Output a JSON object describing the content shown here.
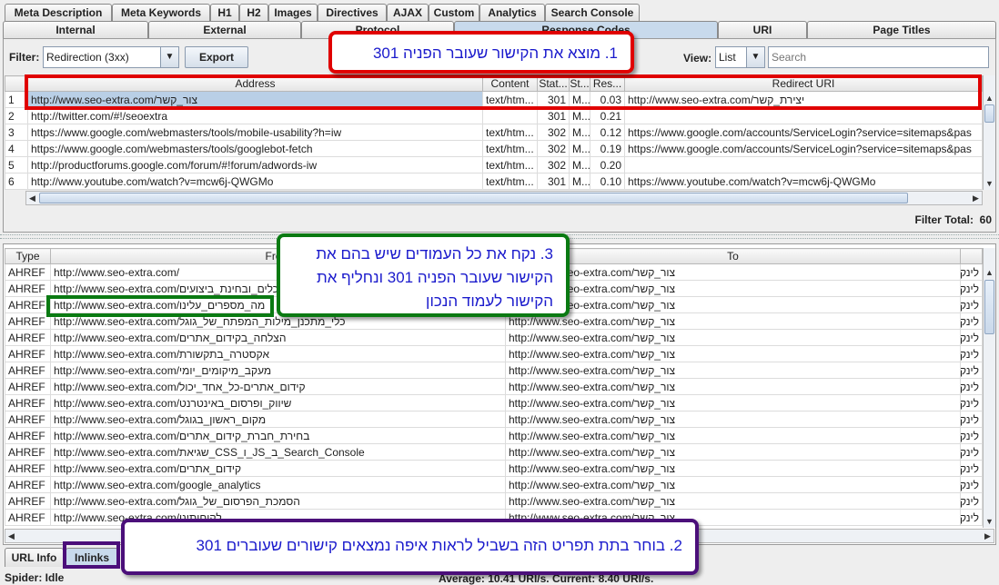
{
  "tabs_row1": [
    "Meta Description",
    "Meta Keywords",
    "H1",
    "H2",
    "Images",
    "Directives",
    "AJAX",
    "Custom",
    "Analytics",
    "Search Console"
  ],
  "tabs_row2": [
    "Internal",
    "External",
    "Protocol",
    "Response Codes",
    "URI",
    "Page Titles"
  ],
  "selected_tab": "Response Codes",
  "toolbar": {
    "filter_label": "Filter:",
    "filter_value": "Redirection (3xx)",
    "export_label": "Export",
    "view_label": "View:",
    "view_value": "List",
    "search_placeholder": "Search"
  },
  "top_table": {
    "columns": [
      "",
      "Address",
      "Content",
      "Stat...",
      "St...",
      "Res...",
      "Redirect URI"
    ],
    "rows": [
      [
        "1",
        "http://www.seo-extra.com/צור_קשר",
        "text/htm...",
        "301",
        "M...",
        "0.03",
        "http://www.seo-extra.com/יצירת_קשר"
      ],
      [
        "2",
        "http://twitter.com/#!/seoextra",
        "",
        "301",
        "M...",
        "0.21",
        ""
      ],
      [
        "3",
        "https://www.google.com/webmasters/tools/mobile-usability?h=iw",
        "text/htm...",
        "302",
        "M...",
        "0.12",
        "https://www.google.com/accounts/ServiceLogin?service=sitemaps&pas"
      ],
      [
        "4",
        "https://www.google.com/webmasters/tools/googlebot-fetch",
        "text/htm...",
        "302",
        "M...",
        "0.19",
        "https://www.google.com/accounts/ServiceLogin?service=sitemaps&pas"
      ],
      [
        "5",
        "http://productforums.google.com/forum/#!forum/adwords-iw",
        "text/htm...",
        "302",
        "M...",
        "0.20",
        ""
      ],
      [
        "6",
        "http://www.youtube.com/watch?v=mcw6j-QWGMo",
        "text/htm...",
        "301",
        "M...",
        "0.10",
        "https://www.youtube.com/watch?v=mcw6j-QWGMo"
      ]
    ]
  },
  "filter_total_label": "Filter Total:",
  "filter_total": "60",
  "bottom_table": {
    "columns": [
      "Type",
      "From",
      "To",
      ""
    ],
    "rows": [
      [
        "AHREF",
        "http://www.seo-extra.com/",
        "http://www.seo-extra.com/צור_קשר",
        "לינק"
      ],
      [
        "AHREF",
        "http://www.seo-extra.com/כלים_ובחינת_ביצועים",
        "http://www.seo-extra.com/צור_קשר",
        "לינק"
      ],
      [
        "AHREF",
        "http://www.seo-extra.com/מה_מספרים_עלינו",
        "http://www.seo-extra.com/צור_קשר",
        "לינק"
      ],
      [
        "AHREF",
        "http://www.seo-extra.com/כלי_מתכנן_מילות_המפתח_של_גוגל",
        "http://www.seo-extra.com/צור_קשר",
        "לינק"
      ],
      [
        "AHREF",
        "http://www.seo-extra.com/הצלחה_בקידום_אתרים",
        "http://www.seo-extra.com/צור_קשר",
        "לינק"
      ],
      [
        "AHREF",
        "http://www.seo-extra.com/אקסטרה_בתקשורת",
        "http://www.seo-extra.com/צור_קשר",
        "לינק"
      ],
      [
        "AHREF",
        "http://www.seo-extra.com/מעקב_מיקומים_יומי",
        "http://www.seo-extra.com/צור_קשר",
        "לינק"
      ],
      [
        "AHREF",
        "http://www.seo-extra.com/קידום_אתרים-כל_אחד_יכול",
        "http://www.seo-extra.com/צור_קשר",
        "לינק"
      ],
      [
        "AHREF",
        "http://www.seo-extra.com/שיווק_ופרסום_באינטרנט",
        "http://www.seo-extra.com/צור_קשר",
        "לינק"
      ],
      [
        "AHREF",
        "http://www.seo-extra.com/מקום_ראשון_בגוגל",
        "http://www.seo-extra.com/צור_קשר",
        "לינק"
      ],
      [
        "AHREF",
        "http://www.seo-extra.com/בחירת_חברת_קידום_אתרים",
        "http://www.seo-extra.com/צור_קשר",
        "לינק"
      ],
      [
        "AHREF",
        "http://www.seo-extra.com/שגיאת_CSS_ו_JS_ב_Search_Console",
        "http://www.seo-extra.com/צור_קשר",
        "לינק"
      ],
      [
        "AHREF",
        "http://www.seo-extra.com/קידום_אתרים",
        "http://www.seo-extra.com/צור_קשר",
        "לינק"
      ],
      [
        "AHREF",
        "http://www.seo-extra.com/google_analytics",
        "http://www.seo-extra.com/צור_קשר",
        "לינק"
      ],
      [
        "AHREF",
        "http://www.seo-extra.com/הסמכת_הפרסום_של_גוגל",
        "http://www.seo-extra.com/צור_קשר",
        "לינק"
      ],
      [
        "AHREF",
        "http://www.seo-extra.com/לקוחותינו",
        "http://www.seo-extra.com/צור_קשר",
        "לינק"
      ]
    ]
  },
  "bottom_tabs": [
    "URL Info",
    "Inlinks"
  ],
  "status": {
    "spider": "Spider: Idle",
    "speed": "Average: 10.41 URI/s. Current: 8.40 URI/s."
  },
  "callouts": {
    "one": "1. מוצא את הקישור שעובר הפניה 301",
    "two": "2. בוחר בתת תפריט הזה בשביל לראות איפה נמצאים קישורים שעוברים 301",
    "three": "3. נקח את כל העמודים שיש בהם את הקישור שעובר הפניה 301 ונחליף את הקישור לעמוד הנכון"
  },
  "colors": {
    "callout_one": "#e00000",
    "callout_two": "#4b0f7a",
    "callout_three": "#0a7a12",
    "callout_text": "#1a1acc",
    "selection": "#b9cfe6"
  }
}
